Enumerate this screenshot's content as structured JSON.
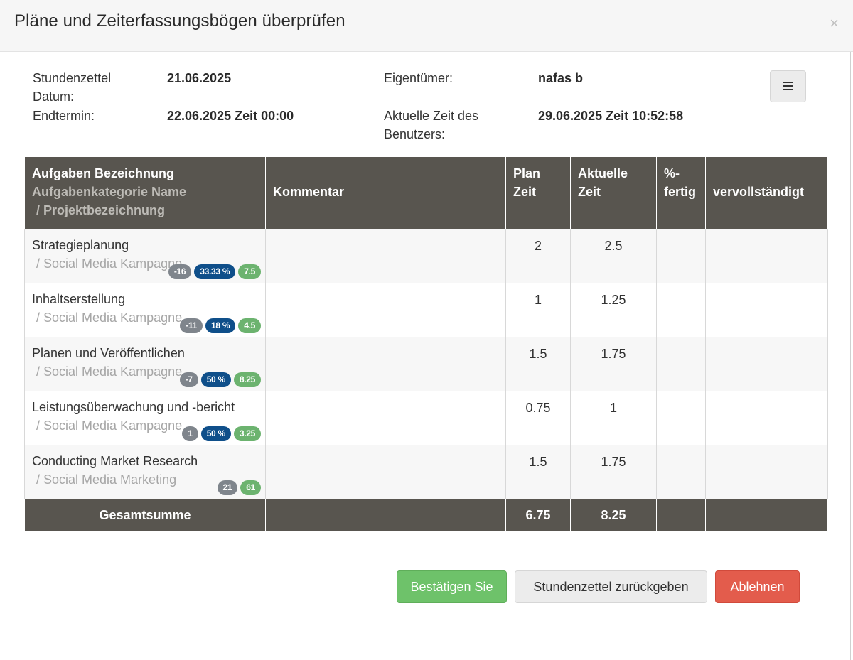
{
  "header": {
    "title": "Pläne und Zeiterfassungsbögen überprüfen",
    "close_label": "×"
  },
  "info": {
    "timesheet_date_label": "Stundenzettel Datum:",
    "timesheet_date_value": "21.06.2025",
    "end_date_label": "Endtermin:",
    "end_date_value": "22.06.2025 Zeit 00:00",
    "owner_label": "Eigentümer:",
    "owner_value": "nafas b",
    "user_time_label": "Aktuelle Zeit des Benutzers:",
    "user_time_value": "29.06.2025 Zeit 10:52:58",
    "menu_icon": "hamburger-icon"
  },
  "table": {
    "columns": {
      "task_title": "Aufgaben Bezeichnung",
      "task_category": "Aufgabenkategorie Name",
      "task_project": "/ Projektbezeichnung",
      "comment": "Kommentar",
      "plan_time": "Plan Zeit",
      "actual_time": "Aktuelle Zeit",
      "percent_done": "%-fertig",
      "completed": "vervollständigt"
    },
    "rows": [
      {
        "name": "Strategieplanung",
        "category": "/ Social Media Kampagne",
        "badges": [
          "-16",
          "33.33 %",
          "7.5"
        ],
        "comment": "",
        "plan": "2",
        "actual": "2.5",
        "percent": "",
        "completed": ""
      },
      {
        "name": "Inhaltserstellung",
        "category": "/ Social Media Kampagne",
        "badges": [
          "-11",
          "18 %",
          "4.5"
        ],
        "comment": "",
        "plan": "1",
        "actual": "1.25",
        "percent": "",
        "completed": ""
      },
      {
        "name": "Planen und Veröffentlichen",
        "category": "/ Social Media Kampagne",
        "badges": [
          "-7",
          "50 %",
          "8.25"
        ],
        "comment": "",
        "plan": "1.5",
        "actual": "1.75",
        "percent": "",
        "completed": ""
      },
      {
        "name": "Leistungsüberwachung und -bericht",
        "category": "/ Social Media Kampagne",
        "badges": [
          "1",
          "50 %",
          "3.25"
        ],
        "comment": "",
        "plan": "0.75",
        "actual": "1",
        "percent": "",
        "completed": ""
      },
      {
        "name": "Conducting Market Research",
        "category": "/ Social Media Marketing",
        "badges": [
          "21",
          "",
          "61"
        ],
        "comment": "",
        "plan": "1.5",
        "actual": "1.75",
        "percent": "",
        "completed": ""
      }
    ],
    "total": {
      "label": "Gesamtsumme",
      "plan": "6.75",
      "actual": "8.25"
    }
  },
  "buttons": {
    "confirm": "Bestätigen Sie",
    "return": "Stundenzettel zurückgeben",
    "reject": "Ablehnen"
  },
  "colors": {
    "header_bg": "#58554f",
    "badge_gray": "#7f858c",
    "badge_blue": "#0f4f8a",
    "badge_green": "#6cb36f",
    "confirm": "#6ec26a",
    "reject": "#e35c4c"
  }
}
